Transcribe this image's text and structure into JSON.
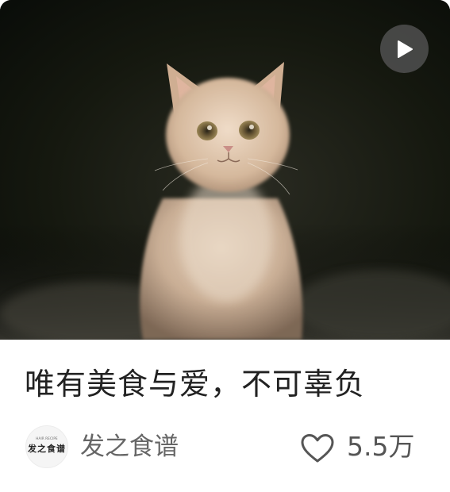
{
  "card": {
    "title": "唯有美食与爱，不可辜负",
    "author": {
      "name": "发之食谱",
      "avatar_small_text": "HAIR RECIPE",
      "avatar_text": "发之食谱"
    },
    "likes": "5.5万",
    "icons": {
      "play": "play-icon",
      "like": "heart-outline-icon"
    },
    "colors": {
      "title": "#222222",
      "author": "#666666",
      "count": "#555555",
      "play_bg": "#505050"
    }
  }
}
